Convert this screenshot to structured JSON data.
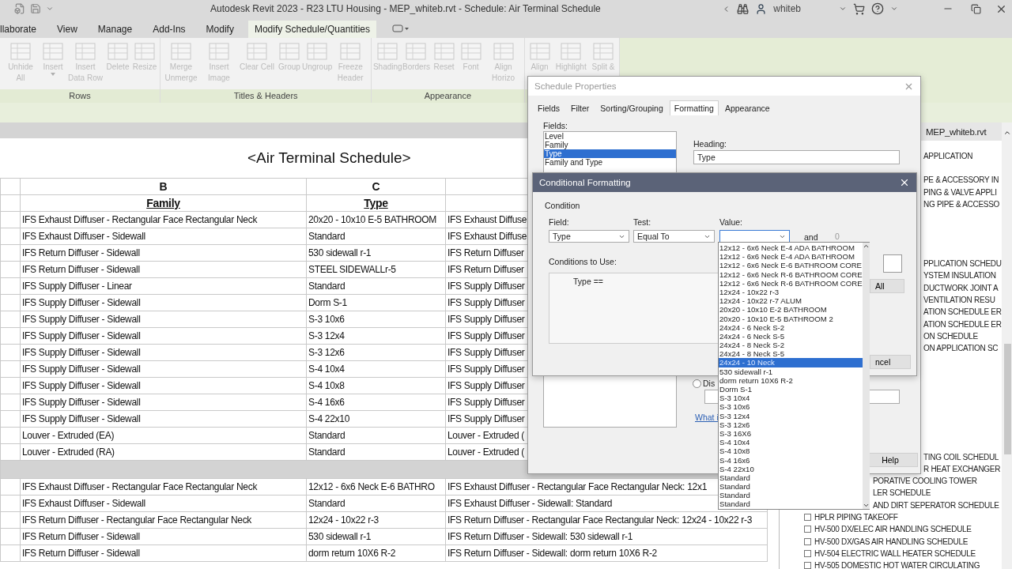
{
  "title_bar": {
    "title": "Autodesk Revit 2023 - R23 LTU Housing - MEP_whiteb.rvt - Schedule: Air Terminal Schedule",
    "user": "whiteb"
  },
  "ribbon_tabs": [
    {
      "label": "llaborate",
      "selected": false
    },
    {
      "label": "View",
      "selected": false
    },
    {
      "label": "Manage",
      "selected": false
    },
    {
      "label": "Add-Ins",
      "selected": false
    },
    {
      "label": "Modify",
      "selected": false
    },
    {
      "label": "Modify Schedule/Quantities",
      "selected": true
    }
  ],
  "ribbon_panels": [
    {
      "label": "Rows",
      "tools": [
        {
          "label": "Unhide All",
          "disabled": true
        },
        {
          "label": "Insert",
          "disabled": true,
          "caret": true
        },
        {
          "label": "Insert Data Row",
          "disabled": true
        },
        {
          "label": "Delete",
          "disabled": true
        },
        {
          "label": "Resize",
          "disabled": true
        }
      ]
    },
    {
      "label": "Titles & Headers",
      "tools": [
        {
          "label": "Merge Unmerge",
          "disabled": true
        },
        {
          "label": "Insert Image",
          "disabled": true
        },
        {
          "label": "Clear Cell",
          "disabled": true
        },
        {
          "label": "Group",
          "disabled": true
        },
        {
          "label": "Ungroup",
          "disabled": true
        },
        {
          "label": "Freeze Header",
          "disabled": true
        }
      ]
    },
    {
      "label": "Appearance",
      "tools": [
        {
          "label": "Shading",
          "disabled": true
        },
        {
          "label": "Borders",
          "disabled": true
        },
        {
          "label": "Reset",
          "disabled": true
        },
        {
          "label": "Font",
          "disabled": true
        },
        {
          "label": "Align Horizo",
          "disabled": true
        }
      ]
    },
    {
      "tools": [
        {
          "label": "Align",
          "disabled": true
        },
        {
          "label": "Highlight",
          "disabled": true
        },
        {
          "label": "Split &",
          "disabled": true
        }
      ]
    }
  ],
  "schedule": {
    "title": "<Air Terminal Schedule>",
    "column_letters": [
      "B",
      "C"
    ],
    "headings": [
      "Family",
      "Type"
    ],
    "rows": [
      [
        "IFS Exhaust Diffuser - Rectangular Face Rectangular Neck",
        "20x20 - 10x10 E-5 BATHROOM",
        "IFS Exhaust Diffuse"
      ],
      [
        "IFS Exhaust Diffuser - Sidewall",
        "Standard",
        "IFS Exhaust Diffuse"
      ],
      [
        "IFS Return Diffuser - Sidewall",
        "530 sidewall r-1",
        "IFS Return Diffuser"
      ],
      [
        "IFS Return Diffuser - Sidewall",
        "STEEL SIDEWALLr-5",
        "IFS Return Diffuser"
      ],
      [
        "IFS Supply Diffuser - Linear",
        "Standard",
        "IFS Supply Diffuser"
      ],
      [
        "IFS Supply Diffuser - Sidewall",
        "Dorm S-1",
        "IFS Supply Diffuser"
      ],
      [
        "IFS Supply Diffuser - Sidewall",
        "S-3 10x6",
        "IFS Supply Diffuser"
      ],
      [
        "IFS Supply Diffuser - Sidewall",
        "S-3 12x4",
        "IFS Supply Diffuser"
      ],
      [
        "IFS Supply Diffuser - Sidewall",
        "S-3 12x6",
        "IFS Supply Diffuser"
      ],
      [
        "IFS Supply Diffuser - Sidewall",
        "S-4 10x4",
        "IFS Supply Diffuser"
      ],
      [
        "IFS Supply Diffuser - Sidewall",
        "S-4 10x8",
        "IFS Supply Diffuser"
      ],
      [
        "IFS Supply Diffuser - Sidewall",
        "S-4 16x6",
        "IFS Supply Diffuser"
      ],
      [
        "IFS Supply Diffuser - Sidewall",
        "S-4 22x10",
        "IFS Supply Diffuser"
      ],
      [
        "Louver - Extruded (EA)",
        "Standard",
        "Louver - Extruded ("
      ],
      [
        "Louver - Extruded (RA)",
        "Standard",
        "Louver - Extruded ("
      ]
    ],
    "lower_rows": [
      [
        "IFS Exhaust Diffuser - Rectangular Face Rectangular Neck",
        "12x12 - 6x6 Neck  E-6 BATHRO",
        "IFS Exhaust Diffuser - Rectangular Face Rectangular Neck: 12x1"
      ],
      [
        "IFS Exhaust Diffuser - Sidewall",
        "Standard",
        "IFS Exhaust Diffuser - Sidewall: Standard"
      ],
      [
        "IFS Return Diffuser - Rectangular Face Rectangular Neck",
        "12x24 - 10x22 r-3",
        "IFS Return Diffuser - Rectangular Face Rectangular Neck: 12x24 - 10x22 r-3"
      ],
      [
        "IFS Return Diffuser - Sidewall",
        "530 sidewall r-1",
        "IFS Return Diffuser - Sidewall: 530 sidewall r-1"
      ],
      [
        "IFS Return Diffuser - Sidewall",
        "dorm return 10X6 R-2",
        "IFS Return Diffuser - Sidewall: dorm return 10X6 R-2"
      ]
    ]
  },
  "project_browser": {
    "title": "MEP_whiteb.rvt",
    "groups": [
      [
        "APPLICATION"
      ],
      [
        "PE & ACCESSORY IN",
        "PING & VALVE APPLI",
        "NG PIPE & ACCESSO"
      ],
      [
        "PPLICATION SCHEDU",
        "YSTEM INSULATION",
        "DUCTWORK JOINT A",
        "VENTILATION RESU",
        "ATION SCHEDULE ER",
        "ATION SCHEDULE ER",
        "ON SCHEDULE",
        "ON APPLICATION SC"
      ],
      [
        "TING COIL SCHEDUL",
        "R HEAT EXCHANGER"
      ],
      [
        "PORATIVE COOLING TOWER",
        "LER SCHEDULE",
        "AND DIRT SEPERATOR SCHEDULE"
      ],
      [
        "HPLR PIPING TAKEOFF",
        "HV-500 DX/ELEC AIR HANDLING SCHEDULE",
        "HV-500 DX/GAS AIR HANDLING SCHEDULE",
        "HV-504 ELECTRIC WALL HEATER SCHEDULE",
        "HV-505 DOMESTIC HOT WATER CIRCULATING"
      ]
    ]
  },
  "schedule_properties": {
    "title": "Schedule Properties",
    "tabs": [
      {
        "label": "Fields",
        "selected": false
      },
      {
        "label": "Filter",
        "selected": false
      },
      {
        "label": "Sorting/Grouping",
        "selected": false
      },
      {
        "label": "Formatting",
        "selected": true
      },
      {
        "label": "Appearance",
        "selected": false
      }
    ],
    "fields_label": "Fields:",
    "fields": [
      {
        "label": "Level",
        "selected": false
      },
      {
        "label": "Family",
        "selected": false
      },
      {
        "label": "Type",
        "selected": true
      },
      {
        "label": "Family and Type",
        "selected": false
      }
    ],
    "heading_label": "Heading:",
    "heading_value": "Type",
    "radio_label": "Dis",
    "radio_checked": false,
    "link": "What i",
    "help_button": "Help"
  },
  "conditional_formatting": {
    "title": "Conditional Formatting",
    "condition_label": "Condition",
    "field_label": "Field:",
    "field_value": "Type",
    "test_label": "Test:",
    "test_value": "Equal To",
    "value_label": "Value:",
    "and_label": "and",
    "and_value": "0",
    "conditions_label": "Conditions to Use:",
    "condition_text": "Type ==",
    "all_button": "All",
    "cancel_button": "ncel",
    "options": [
      {
        "label": "12x12 - 6x6 Neck  E-4 ADA BATHROOM",
        "selected": false
      },
      {
        "label": "12x12 - 6x6 Neck  E-4 ADA BATHROOM",
        "selected": false
      },
      {
        "label": "12x12 - 6x6 Neck  E-6 BATHROOM CORE",
        "selected": false
      },
      {
        "label": "12x12 - 6x6 Neck  R-6 BATHROOM CORE",
        "selected": false
      },
      {
        "label": "12x12 - 6x6 Neck  R-6 BATHROOM CORE",
        "selected": false
      },
      {
        "label": "12x24 - 10x22 r-3",
        "selected": false
      },
      {
        "label": "12x24 - 10x22 r-7 ALUM",
        "selected": false
      },
      {
        "label": "20x20 - 10x10 E-2 BATHROOM",
        "selected": false
      },
      {
        "label": "20x20 - 10x10 E-5 BATHROOM 2",
        "selected": false
      },
      {
        "label": "24x24 - 6 Neck S-2",
        "selected": false
      },
      {
        "label": "24x24 - 6 Neck S-5",
        "selected": false
      },
      {
        "label": "24x24 - 8 Neck S-2",
        "selected": false
      },
      {
        "label": "24x24 - 8 Neck S-5",
        "selected": false
      },
      {
        "label": "24x24 - 10 Neck",
        "selected": true
      },
      {
        "label": "530 sidewall r-1",
        "selected": false
      },
      {
        "label": "dorm return 10X6 R-2",
        "selected": false
      },
      {
        "label": "Dorm S-1",
        "selected": false
      },
      {
        "label": "S-3 10x4",
        "selected": false
      },
      {
        "label": "S-3 10x6",
        "selected": false
      },
      {
        "label": "S-3 12x4",
        "selected": false
      },
      {
        "label": "S-3 12x6",
        "selected": false
      },
      {
        "label": "S-3 16X6",
        "selected": false
      },
      {
        "label": "S-4 10x4",
        "selected": false
      },
      {
        "label": "S-4 10x8",
        "selected": false
      },
      {
        "label": "S-4 16x6",
        "selected": false
      },
      {
        "label": "S-4 22x10",
        "selected": false
      },
      {
        "label": "Standard",
        "selected": false
      },
      {
        "label": "Standard",
        "selected": false
      },
      {
        "label": "Standard",
        "selected": false
      },
      {
        "label": "Standard",
        "selected": false
      }
    ]
  }
}
